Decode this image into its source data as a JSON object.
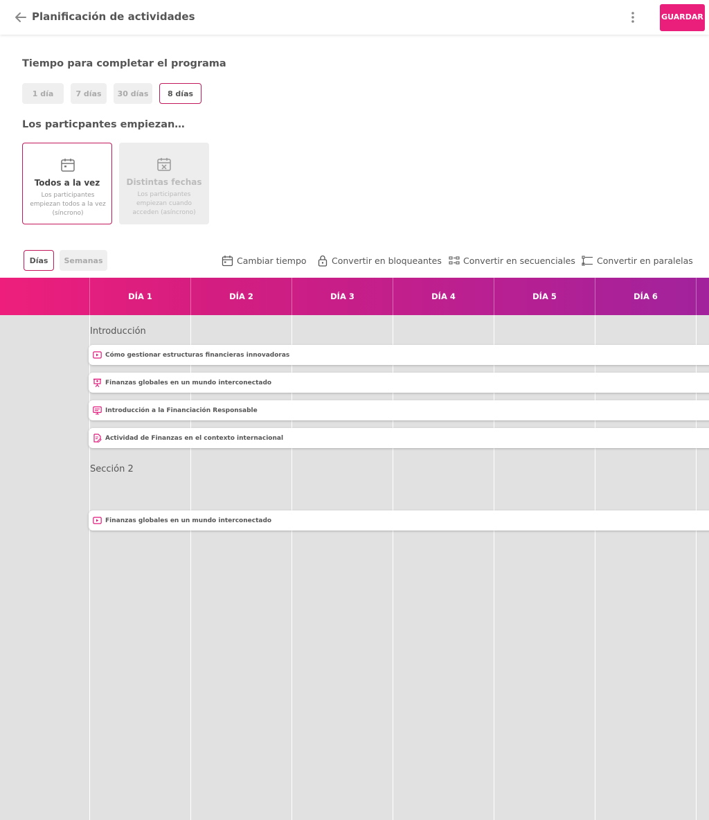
{
  "header": {
    "title": "Planificación de actividades",
    "save_label": "GUARDAR"
  },
  "completion": {
    "heading": "Tiempo para completar el programa",
    "options": [
      {
        "label": "1 día",
        "selected": false
      },
      {
        "label": "7 días",
        "selected": false
      },
      {
        "label": "30 días",
        "selected": false
      },
      {
        "label": "8 días",
        "selected": true
      }
    ]
  },
  "start_mode": {
    "heading": "Los particpantes empiezan…",
    "options": [
      {
        "title": "Todos a la vez",
        "desc": "Los participantes empiezan todos a la vez (síncrono)",
        "icon": "calendar-icon",
        "selected": true
      },
      {
        "title": "Distintas fechas",
        "desc": "Los participantes empiezan cuando acceden (asíncrono)",
        "icon": "calendar-off-icon",
        "selected": false
      }
    ]
  },
  "view": {
    "options": [
      {
        "label": "Días",
        "selected": true
      },
      {
        "label": "Semanas",
        "selected": false
      }
    ]
  },
  "actions": [
    {
      "label": "Cambiar tiempo",
      "icon": "calendar-icon"
    },
    {
      "label": "Convertir en bloqueantes",
      "icon": "lock-icon"
    },
    {
      "label": "Convertir en secuenciales",
      "icon": "sequential-icon"
    },
    {
      "label": "Convertir en paralelas",
      "icon": "parallel-icon"
    }
  ],
  "grid": {
    "days": [
      "DÍA 1",
      "DÍA 2",
      "DÍA 3",
      "DÍA 4",
      "DÍA 5",
      "DÍA 6"
    ],
    "sections": [
      {
        "title": "Introducción",
        "activities": [
          {
            "label": "Cómo gestionar estructuras financieras innovadoras",
            "icon": "video-icon"
          },
          {
            "label": "Finanzas globales en un mundo interconectado",
            "icon": "presentation-icon"
          },
          {
            "label": "Introducción a la Financiación  Responsable",
            "icon": "screen-icon"
          },
          {
            "label": "Actividad de Finanzas en el contexto internacional",
            "icon": "document-edit-icon"
          }
        ]
      },
      {
        "title": "Sección 2",
        "activities": [
          {
            "label": "Finanzas globales en un mundo interconectado",
            "icon": "video-icon"
          }
        ]
      }
    ]
  },
  "colors": {
    "accent": "#ea1f7b",
    "selected_border": "#c2185b",
    "grid_background": "#e1e1e1",
    "header_gradient_start": "#ee1f7c",
    "header_gradient_end": "#a1229c"
  }
}
